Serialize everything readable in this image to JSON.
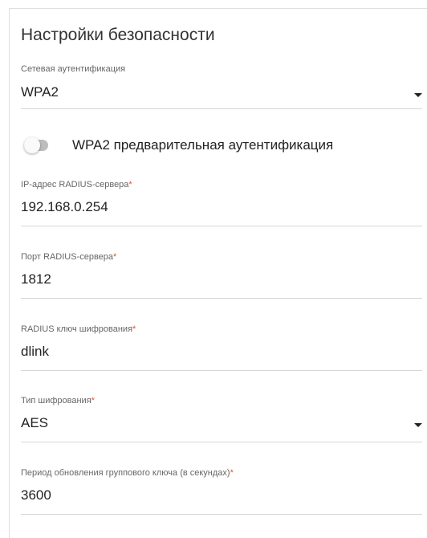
{
  "section": {
    "title": "Настройки безопасности"
  },
  "auth": {
    "label": "Сетевая аутентификация",
    "value": "WPA2"
  },
  "preauth": {
    "label": "WPA2 предварительная аутентификация",
    "enabled": false
  },
  "radius_ip": {
    "label": "IP-адрес RADIUS-сервера",
    "required_mark": "*",
    "value": "192.168.0.254"
  },
  "radius_port": {
    "label": "Порт RADIUS-сервера",
    "required_mark": "*",
    "value": "1812"
  },
  "radius_key": {
    "label": "RADIUS ключ шифрования",
    "required_mark": "*",
    "value": "dlink"
  },
  "encryption": {
    "label": "Тип шифрования",
    "required_mark": "*",
    "value": "AES"
  },
  "group_key_period": {
    "label": "Период обновления группового ключа (в секундах)",
    "required_mark": "*",
    "value": "3600"
  },
  "colors": {
    "required": "#e8512a",
    "toggle_off": "#bdbdbd",
    "border": "#dedede"
  },
  "icons": {
    "dropdown": "caret-down-icon"
  }
}
